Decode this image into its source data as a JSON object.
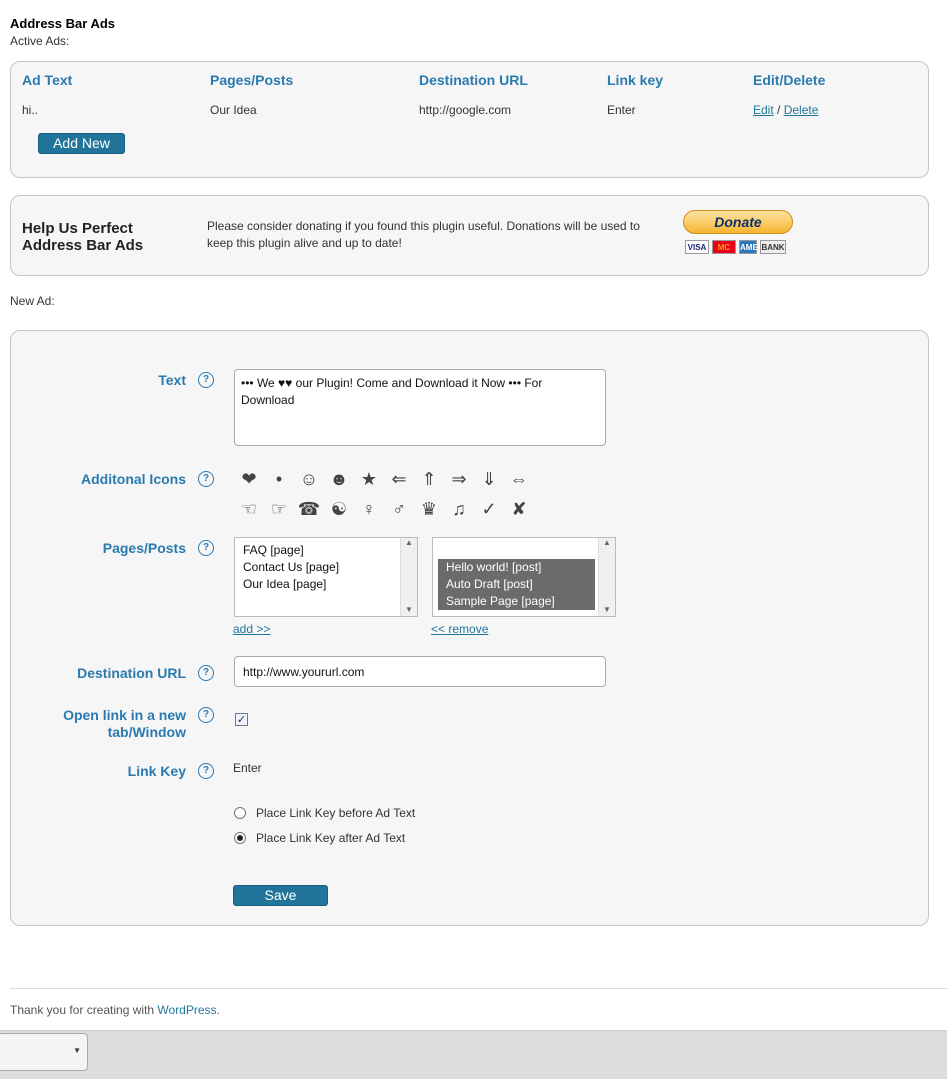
{
  "header": {
    "title": "Address Bar Ads",
    "subtitle": "Active Ads:"
  },
  "ads_table": {
    "columns": [
      "Ad Text",
      "Pages/Posts",
      "Destination URL",
      "Link key",
      "Edit/Delete"
    ],
    "rows": [
      {
        "ad_text": "hi..",
        "pages": "Our Idea",
        "url": "http://google.com",
        "link_key": "Enter",
        "edit": "Edit",
        "sep": "/",
        "delete": "Delete"
      }
    ],
    "add_new_label": "Add New"
  },
  "donate": {
    "title_line1": "Help Us Perfect",
    "title_line2": "Address Bar Ads",
    "text": "Please consider donating if you found this plugin useful. Donations will be used to keep this plugin alive and up to date!",
    "button_label": "Donate",
    "cards": [
      "VISA",
      "MC",
      "AMEX",
      "BANK"
    ]
  },
  "new_ad": {
    "section_label": "New Ad:",
    "labels": {
      "text": "Text",
      "icons": "Additonal Icons",
      "pages": "Pages/Posts",
      "url": "Destination URL",
      "open_new_line1": "Open link in a new",
      "open_new_line2": "tab/Window",
      "link_key": "Link Key"
    },
    "help_glyph": "?",
    "text_value": "••• We ♥♥ our Plugin! Come and Download it Now ••• For Download",
    "icons_row1": [
      "❤",
      "•",
      "☺",
      "☻",
      "★",
      "⇐",
      "⇑",
      "⇒",
      "⇓",
      "⇔"
    ],
    "icons_row2": [
      "☜",
      "☞",
      "☎",
      "☯",
      "♀",
      "♂",
      "♛",
      "♫",
      "✓",
      "✘"
    ],
    "available_pages": [
      "FAQ  [page]",
      "Contact Us  [page]",
      "Our Idea  [page]"
    ],
    "selected_pages": [
      "Hello world!  [post]",
      "Auto Draft  [post]",
      "Sample Page  [page]"
    ],
    "add_link": "add >>",
    "remove_link": "<< remove",
    "url_value": "http://www.yoururl.com",
    "open_new_checked": true,
    "checkbox_glyph": "✓",
    "link_key_value": "Enter",
    "radio_before": "Place Link Key before Ad Text",
    "radio_after": "Place Link Key after Ad Text",
    "radio_selected": "after",
    "save_label": "Save"
  },
  "footer": {
    "text": "Thank you for creating with ",
    "link": "WordPress",
    "suffix": "."
  },
  "colors": {
    "accent": "#21759b",
    "label": "#2a7ab0",
    "panel": "#f6f6f6",
    "border": "#c6c6c6"
  }
}
